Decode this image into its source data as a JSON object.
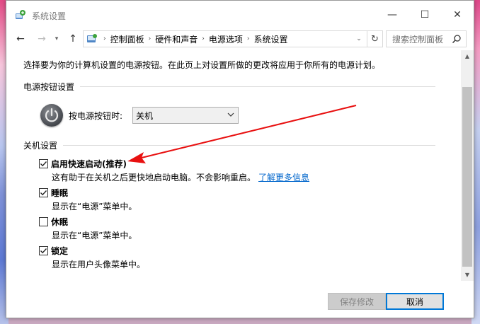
{
  "window": {
    "title": "系统设置",
    "minimize_glyph": "—",
    "maximize_glyph": "☐",
    "close_glyph": "✕"
  },
  "nav": {
    "back_glyph": "←",
    "forward_glyph": "→",
    "history_glyph": "▾",
    "up_glyph": "↑",
    "breadcrumbs": [
      "控制面板",
      "硬件和声音",
      "电源选项",
      "系统设置"
    ],
    "crumb_sep": "›",
    "dropdown_glyph": "⌄",
    "refresh_glyph": "↻",
    "search_placeholder": "搜索控制面板"
  },
  "content": {
    "intro": "选择要为你的计算机设置的电源按钮。在此页上对设置所做的更改将应用于你所有的电源计划。",
    "power_section": {
      "heading": "电源按钮设置",
      "label": "按电源按钮时:",
      "selected": "关机"
    },
    "shutdown_section": {
      "heading": "关机设置",
      "options": [
        {
          "label": "启用快速启动(推荐)",
          "checked": true,
          "desc": "这有助于在关机之后更快地启动电脑。不会影响重启。",
          "link": "了解更多信息"
        },
        {
          "label": "睡眠",
          "checked": true,
          "desc": "显示在“电源”菜单中。"
        },
        {
          "label": "休眠",
          "checked": false,
          "desc": "显示在“电源”菜单中。"
        },
        {
          "label": "锁定",
          "checked": true,
          "desc": "显示在用户头像菜单中。"
        }
      ]
    }
  },
  "scrollbar": {
    "up_glyph": "▲",
    "down_glyph": "▼"
  },
  "footer": {
    "save_label": "保存修改",
    "cancel_label": "取消"
  },
  "colors": {
    "link": "#0066cc",
    "annotation_arrow": "#e81010",
    "focus_border": "#0078d7"
  }
}
